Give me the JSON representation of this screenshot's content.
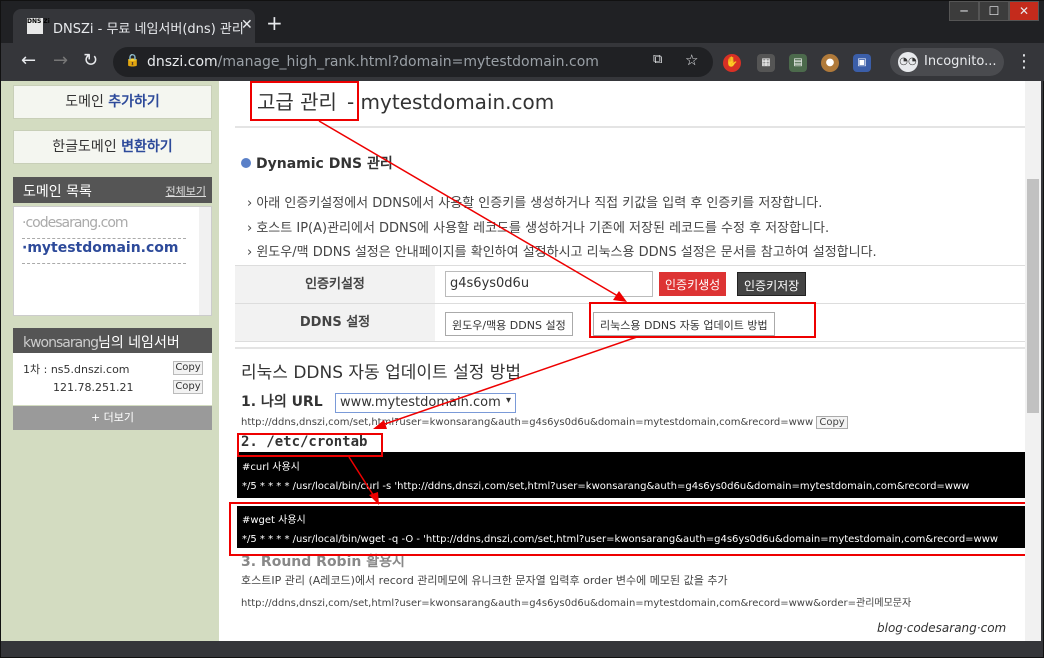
{
  "browser": {
    "tab_title": "DNSZi - 무료 네임서버(dns) 관리",
    "favicon_text": "DNS Zi",
    "url_domain": "dnszi.com",
    "url_path": "/manage_high_rank.html?domain=mytestdomain.com",
    "profile_label": "Incognito..."
  },
  "sidebar": {
    "add_domain": {
      "prefix": "도메인 ",
      "bold": "추가하기"
    },
    "convert_domain": {
      "prefix": "한글도메인 ",
      "bold": "변환하기"
    },
    "domain_list_title": "도메인 목록",
    "view_all": "전체보기",
    "domains": [
      "·codesarang.com",
      "·mytestdomain.com"
    ],
    "ns_title_suffix": "님의 네임서버",
    "ns_name": "1차 : ns5.dnszi.com",
    "ns_ip": "121.78.251.21",
    "copy": "Copy",
    "more": "+ 더보기"
  },
  "main": {
    "title": "고급 관리",
    "title_domain": "- mytestdomain.com",
    "section": "Dynamic DNS 관리",
    "info": [
      "아래 인증키설정에서 DDNS에서 사용할 인증키를 생성하거나 직접 키값을 입력 후 인증키를 저장합니다.",
      "호스트 IP(A)관리에서 DDNS에 사용할 레코드를 생성하거나 기존에 저장된 레코드를 수정 후 저장합니다.",
      "윈도우/맥 DDNS 설정은 안내페이지를 확인하여 설정하시고 리눅스용 DDNS 설정은 문서를 참고하여 설정합니다."
    ],
    "key_label": "인증키설정",
    "key_value": "g4s6ys0d6u",
    "gen_key": "인증키생성",
    "save_key": "인증키저장",
    "ddns_label": "DDNS 설정",
    "win_btn": "윈도우/맥용 DDNS 설정",
    "linux_btn": "리눅스용 DDNS 자동 업데이트 방법",
    "guide_title": "리눅스 DDNS 자동 업데이트 설정 방법",
    "step1": "1. 나의 URL",
    "domain_select": "www.mytestdomain.com",
    "url1": "http://ddns,dnszi,com/set,html?user=kwonsarang&auth=g4s6ys0d6u&domain=mytestdomain,com&record=www",
    "copy": "Copy",
    "step2": "2. /etc/crontab",
    "curl_label": "#curl 사용시",
    "curl_cmd": "*/5 * * * * /usr/local/bin/curl -s 'http://ddns,dnszi,com/set,html?user=kwonsarang&auth=g4s6ys0d6u&domain=mytestdomain,com&record=www",
    "wget_label": "#wget 사용시",
    "wget_cmd": "*/5 * * * * /usr/local/bin/wget -q -O - 'http://ddns,dnszi,com/set,html?user=kwonsarang&auth=g4s6ys0d6u&domain=mytestdomain,com&record=www",
    "step3": "3. Round Robin 활용시",
    "step3_desc": "호스트IP 관리 (A레코드)에서 record 관리메모에 유니크한 문자열 입력후 order 변수에 메모된 값을 추가",
    "url3": "http://ddns,dnszi,com/set,html?user=kwonsarang&auth=g4s6ys0d6u&domain=mytestdomain,com&record=www&order=관리메모문자"
  },
  "watermark": "blog·codesarang·com"
}
